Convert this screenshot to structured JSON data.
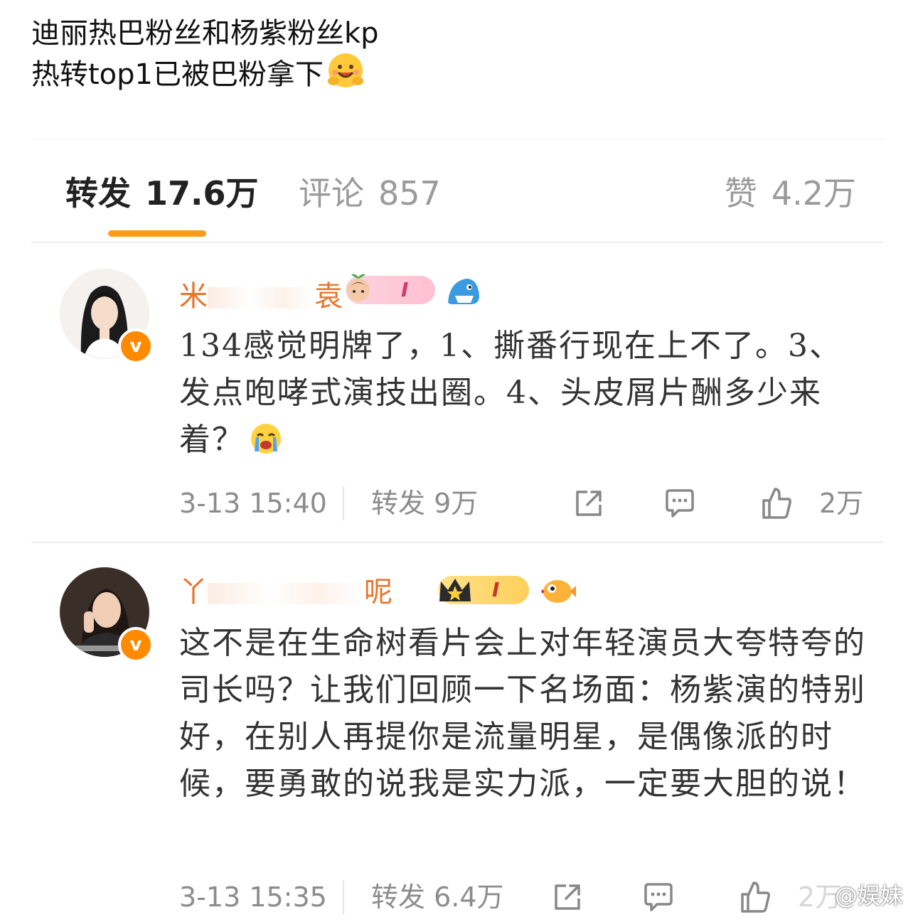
{
  "post": {
    "line1": "迪丽热巴粉丝和杨紫粉丝kp",
    "line2": "热转top1已被巴粉拿下"
  },
  "tabs": {
    "repost_label": "转发",
    "repost_count": "17.6万",
    "comments_label": "评论",
    "comments_count": "857",
    "likes_label": "赞",
    "likes_count": "4.2万"
  },
  "comments": [
    {
      "username_start": "米",
      "username_end": "袁",
      "level": "I",
      "text": "134感觉明牌了，1、撕番行现在上不了。3、发点咆哮式演技出圈。4、头皮屑片酬多少来着？",
      "time": "3-13 15:40",
      "repost": "转发 9万",
      "likes": "2万",
      "icons": [
        "share-icon",
        "comment-icon",
        "thumbs-up-icon"
      ]
    },
    {
      "username_start": "丫",
      "username_end": "呢",
      "level": "I",
      "text": "这不是在生命树看片会上对年轻演员大夸特夸的司长吗？让我们回顾一下名场面：杨紫演的特别好，在别人再提你是流量明星，是偶像派的时候，要勇敢的说我是实力派，一定要大胆的说！",
      "time": "3-13 15:35",
      "repost": "转发 6.4万",
      "likes": "2万",
      "icons": [
        "share-icon",
        "comment-icon",
        "thumbs-up-icon"
      ]
    }
  ],
  "watermark": "@娱妹",
  "colors": {
    "accent": "#ff9a1a",
    "username": "#e8742a",
    "verified": "#ff8a00"
  }
}
